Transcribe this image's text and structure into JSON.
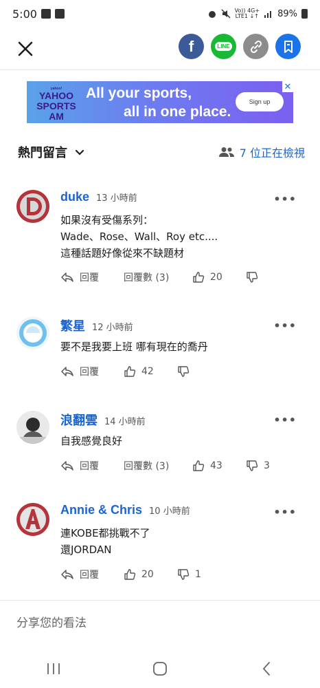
{
  "status_bar": {
    "time": "5:00",
    "network_top": "Vo)) 4G+",
    "network_bottom": "LTE1 ↓↑",
    "battery": "89%"
  },
  "ad": {
    "logo_small": "yahoo!",
    "logo_line1": "YAHOO",
    "logo_line2": "SPORTS",
    "logo_line3": "AM",
    "headline_1": "All your sports,",
    "headline_2": "all in one place.",
    "cta": "Sign up",
    "close_glyph": "✕"
  },
  "comments_header": {
    "sort_label": "熱門留言",
    "viewers_label": "7 位正在檢視"
  },
  "comments": [
    {
      "name": "duke",
      "time": "13 小時前",
      "lines": [
        "如果沒有受傷系列：",
        "Wade、Rose、Wall、Roy etc....",
        "這種話題好像從來不缺題材"
      ],
      "reply": "回覆",
      "replies": "回覆數 (3)",
      "likes": "20",
      "dislikes": ""
    },
    {
      "name": "繁星",
      "time": "12 小時前",
      "lines": [
        "要不是我要上班 哪有現在的喬丹"
      ],
      "reply": "回覆",
      "replies": "",
      "likes": "42",
      "dislikes": ""
    },
    {
      "name": "浪翻雲",
      "time": "14 小時前",
      "lines": [
        "自我感覺良好"
      ],
      "reply": "回覆",
      "replies": "回覆數 (3)",
      "likes": "43",
      "dislikes": "3"
    },
    {
      "name": "Annie & Chris",
      "time": "10 小時前",
      "lines": [
        "連KOBE都挑戰不了",
        "還JORDAN"
      ],
      "reply": "回覆",
      "replies": "",
      "likes": "20",
      "dislikes": "1"
    }
  ],
  "share_input": {
    "placeholder": "分享您的看法"
  },
  "colors": {
    "accent": "#1a64d4",
    "facebook": "#3d5a98",
    "line": "#19b936",
    "bookmark": "#1a73e8"
  }
}
